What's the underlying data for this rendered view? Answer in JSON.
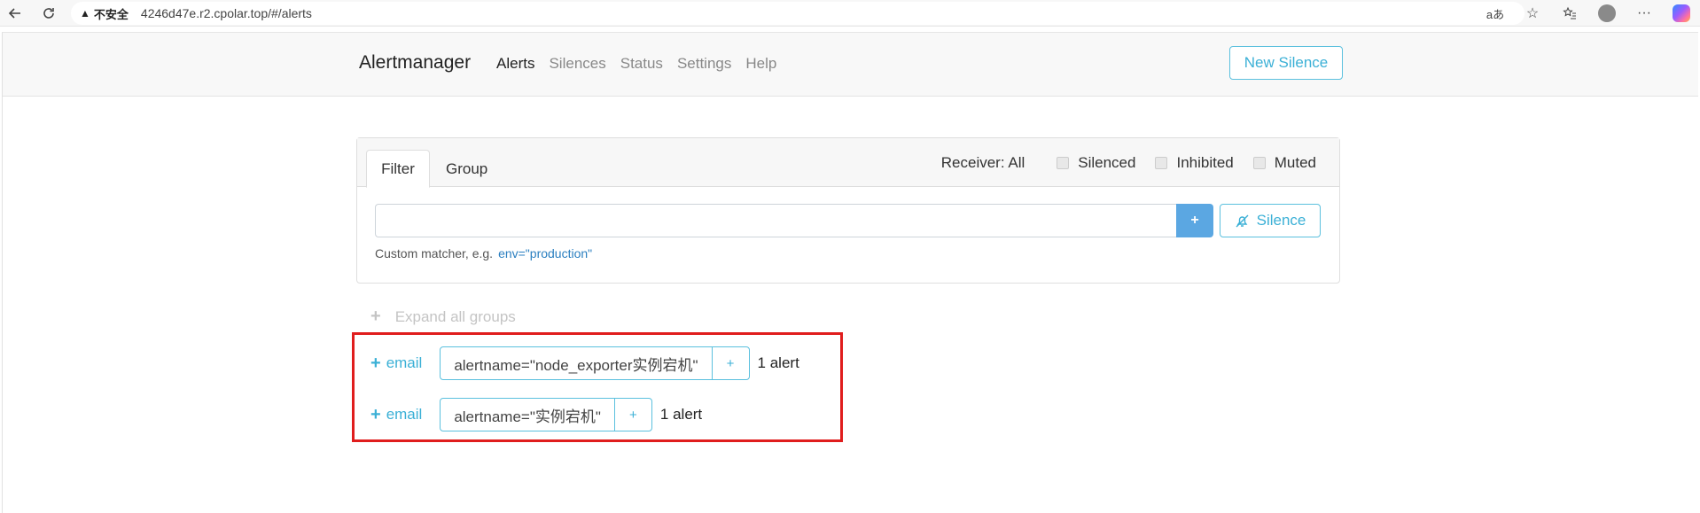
{
  "browser": {
    "insecure_label": "不安全",
    "url": "4246d47e.r2.cpolar.top/#/alerts"
  },
  "navbar": {
    "brand": "Alertmanager",
    "links": [
      "Alerts",
      "Silences",
      "Status",
      "Settings",
      "Help"
    ],
    "active": "Alerts",
    "new_silence": "New Silence"
  },
  "filter_card": {
    "tabs": [
      "Filter",
      "Group"
    ],
    "receiver_label": "Receiver: All",
    "checkboxes": [
      "Silenced",
      "Inhibited",
      "Muted"
    ],
    "input_value": "",
    "add_button": "+",
    "silence_button": "Silence",
    "help_prefix": "Custom matcher, e.g.",
    "help_example": "env=\"production\""
  },
  "groups": {
    "expand_all": "Expand all groups",
    "items": [
      {
        "receiver": "email",
        "label": "alertname=\"node_exporter实例宕机\"",
        "count": "1 alert"
      },
      {
        "receiver": "email",
        "label": "alertname=\"实例宕机\"",
        "count": "1 alert"
      }
    ]
  },
  "colors": {
    "accent": "#5bc0de",
    "primary": "#5ba7e2",
    "highlight_box": "#e01d1d"
  }
}
